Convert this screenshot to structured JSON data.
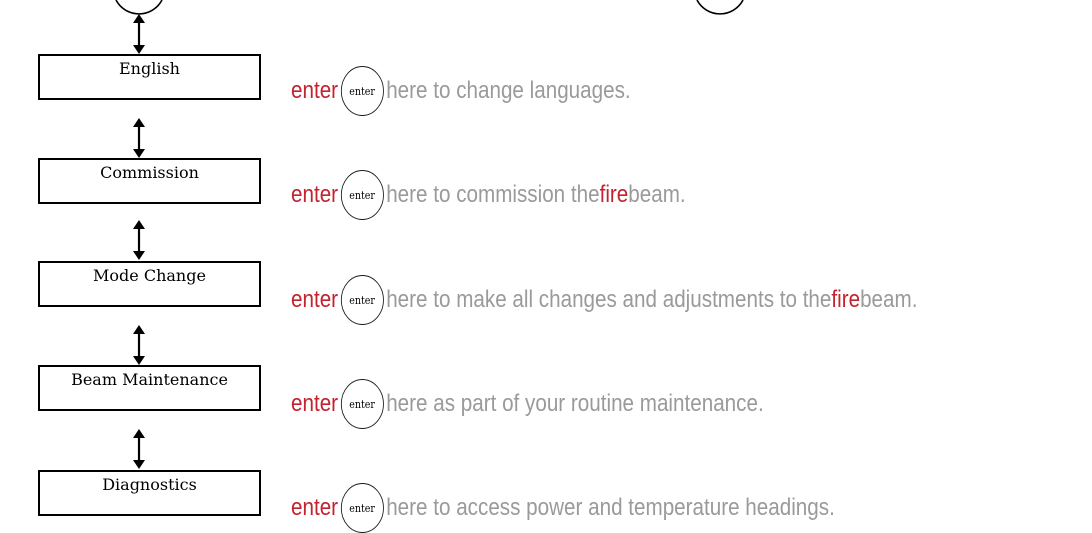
{
  "menu": {
    "items": [
      {
        "label": "English"
      },
      {
        "label": "Commission"
      },
      {
        "label": "Mode Change"
      },
      {
        "label": "Beam Maintenance"
      },
      {
        "label": "Diagnostics"
      }
    ]
  },
  "instructions": {
    "enter_word": "enter",
    "key_label": "enter",
    "rows": [
      {
        "text": "here to change languages."
      },
      {
        "text": "here to commission the",
        "brand": "fire",
        "suffix": "beam."
      },
      {
        "text": "here to make all changes and adjustments to the",
        "brand": "fire",
        "suffix": "beam."
      },
      {
        "text": "here as part of your routine maintenance."
      },
      {
        "text": "here to access power and temperature headings."
      }
    ]
  },
  "colors": {
    "accent_red": "#c4222e",
    "muted_text": "#9a9a9a",
    "line": "#000000"
  }
}
